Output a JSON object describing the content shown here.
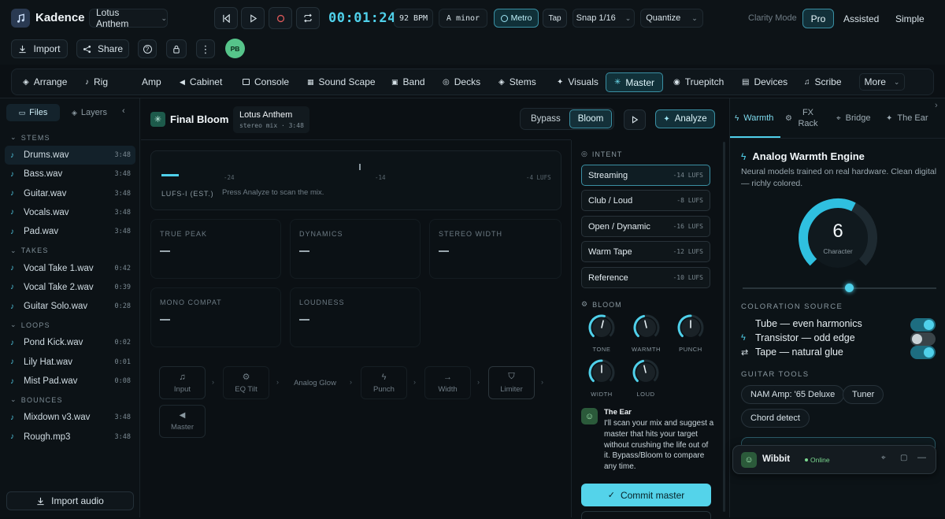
{
  "app": {
    "name": "Kadence",
    "project": "Lotus Anthem"
  },
  "transport": {
    "time": "00:01:24",
    "bpm": "92 BPM",
    "key": "A minor",
    "metro_label": "Metro",
    "tap_label": "Tap",
    "snap": "Snap 1/16",
    "quantize": "Quantize"
  },
  "clarity": {
    "label": "Clarity Mode",
    "modes": [
      "Pro",
      "Assisted",
      "Simple"
    ],
    "active": "Pro"
  },
  "actions": {
    "import": "Import",
    "share": "Share",
    "avatar": "PB"
  },
  "nav": {
    "items": [
      "Arrange",
      "Rig",
      "Amp",
      "Cabinet",
      "Console",
      "Sound Scape",
      "Band",
      "Decks",
      "Stems",
      "Visuals",
      "Master",
      "Truepitch",
      "Devices",
      "Scribe",
      "More"
    ],
    "active": "Master"
  },
  "sidebar": {
    "tabs": [
      "Files",
      "Layers"
    ],
    "sections": [
      {
        "title": "STEMS",
        "files": [
          {
            "name": "Drums.wav",
            "dur": "3:48"
          },
          {
            "name": "Bass.wav",
            "dur": "3:48"
          },
          {
            "name": "Guitar.wav",
            "dur": "3:48"
          },
          {
            "name": "Vocals.wav",
            "dur": "3:48"
          },
          {
            "name": "Pad.wav",
            "dur": "3:48"
          }
        ]
      },
      {
        "title": "TAKES",
        "files": [
          {
            "name": "Vocal Take 1.wav",
            "dur": "0:42"
          },
          {
            "name": "Vocal Take 2.wav",
            "dur": "0:39"
          },
          {
            "name": "Guitar Solo.wav",
            "dur": "0:28"
          }
        ]
      },
      {
        "title": "LOOPS",
        "files": [
          {
            "name": "Pond Kick.wav",
            "dur": "0:02"
          },
          {
            "name": "Lily Hat.wav",
            "dur": "0:01"
          },
          {
            "name": "Mist Pad.wav",
            "dur": "0:08"
          }
        ]
      },
      {
        "title": "BOUNCES",
        "files": [
          {
            "name": "Mixdown v3.wav",
            "dur": "3:48"
          },
          {
            "name": "Rough.mp3",
            "dur": "3:48"
          }
        ]
      }
    ],
    "import_audio": "Import audio"
  },
  "master": {
    "title": "Final Bloom",
    "track": {
      "name": "Lotus Anthem",
      "meta": "stereo mix · 3:48"
    },
    "bypass": "Bypass",
    "bloom": "Bloom",
    "analyze": "Analyze",
    "lufs_label": "LUFS-I (EST.)",
    "scale": [
      "-24",
      "-14",
      "-4 LUFS"
    ],
    "hint": "Press Analyze to scan the mix.",
    "metrics": [
      "TRUE PEAK",
      "DYNAMICS",
      "STEREO WIDTH",
      "MONO COMPAT",
      "LOUDNESS"
    ],
    "chain": [
      "Input",
      "EQ Tilt",
      "Analog Glow",
      "Punch",
      "Width",
      "Limiter",
      "Master"
    ]
  },
  "intent": {
    "title": "INTENT",
    "options": [
      {
        "label": "Streaming",
        "lufs": "-14 LUFS"
      },
      {
        "label": "Club / Loud",
        "lufs": "-8 LUFS"
      },
      {
        "label": "Open / Dynamic",
        "lufs": "-16 LUFS"
      },
      {
        "label": "Warm Tape",
        "lufs": "-12 LUFS"
      },
      {
        "label": "Reference",
        "lufs": "-10 LUFS"
      }
    ],
    "active": "Streaming",
    "bloom_title": "BLOOM",
    "knobs": [
      {
        "label": "TONE",
        "level": 0.55
      },
      {
        "label": "WARMTH",
        "level": 0.45
      },
      {
        "label": "PUNCH",
        "level": 0.5
      },
      {
        "label": "WIDTH",
        "level": 0.5
      },
      {
        "label": "LOUD",
        "level": 0.45
      }
    ],
    "ear_name": "The Ear",
    "ear_msg": "I'll scan your mix and suggest a master that hits your target without crushing the life out of it. Bypass/Bloom to compare any time.",
    "commit": "Commit master"
  },
  "right": {
    "tabs": [
      "Warmth",
      "FX Rack",
      "Bridge",
      "The Ear"
    ],
    "active_tab": "Warmth",
    "engine_title": "Analog Warmth Engine",
    "engine_desc": "Neural models trained on real hardware. Clean digital — richly colored.",
    "dial_value": "6",
    "dial_label": "Character",
    "dial_level": 0.6,
    "slider_level": 0.55,
    "coloration_title": "COLORATION SOURCE",
    "sources": [
      {
        "label": "Tube — even harmonics",
        "on": true
      },
      {
        "label": "Transistor — odd edge",
        "on": false
      },
      {
        "label": "Tape — natural glue",
        "on": true
      }
    ],
    "guitar_title": "GUITAR TOOLS",
    "guitar_tools": [
      "NAM Amp: '65 Deluxe",
      "Tuner",
      "Chord detect"
    ],
    "wibbit": {
      "name": "Wibbit",
      "status": "Online"
    }
  },
  "colors": {
    "accent": "#4fd0ea",
    "bg": "#0b1014",
    "online": "#7bd88f"
  }
}
